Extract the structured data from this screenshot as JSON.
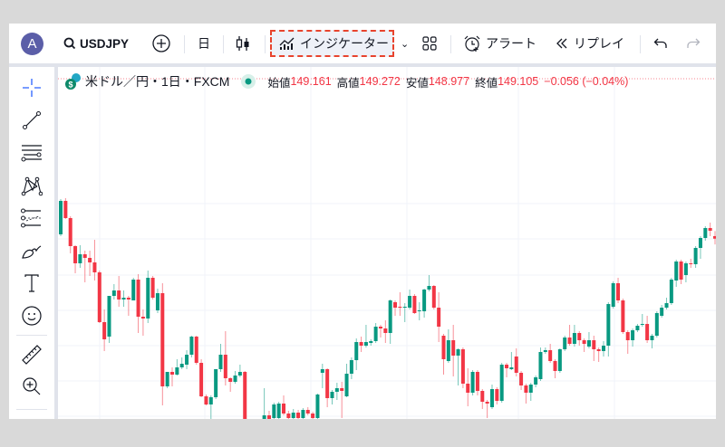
{
  "toolbar": {
    "avatar_letter": "A",
    "symbol": "USDJPY",
    "interval": "日",
    "indicators_label": "インジケーター",
    "alert_label": "アラート",
    "replay_label": "リプレイ"
  },
  "legend": {
    "title": "米ドル／円・1日・FXCM",
    "open_label": "始値",
    "open": "149.161",
    "high_label": "高値",
    "high": "149.272",
    "low_label": "安値",
    "low": "148.977",
    "close_label": "終値",
    "close": "149.105",
    "change": "−0.056 (−0.04%)"
  },
  "left_tools": [
    "crosshair",
    "trend-line",
    "horizontal-lines",
    "pattern",
    "fib-retracement",
    "brush",
    "text",
    "emoji",
    "ruler",
    "zoom-in"
  ],
  "colors": {
    "up": "#089981",
    "down": "#f23645",
    "accent": "#2962ff",
    "highlight": "#e8432d"
  },
  "chart_data": {
    "type": "candlestick",
    "symbol": "USDJPY",
    "interval": "1D",
    "ohlc": [
      [
        149.2,
        149.98,
        149.16,
        149.94
      ],
      [
        149.94,
        150.0,
        149.54,
        149.56
      ],
      [
        149.56,
        149.6,
        148.78,
        148.94
      ],
      [
        148.94,
        148.96,
        148.34,
        148.56
      ],
      [
        148.56,
        148.96,
        148.46,
        148.76
      ],
      [
        148.76,
        148.84,
        148.14,
        148.68
      ],
      [
        148.68,
        148.84,
        148.28,
        148.58
      ],
      [
        148.58,
        149.08,
        148.18,
        148.36
      ],
      [
        148.36,
        148.4,
        147.24,
        147.26
      ],
      [
        147.26,
        147.54,
        146.62,
        146.88
      ],
      [
        146.94,
        146.96,
        146.8,
        147.84
      ],
      [
        147.84,
        148.1,
        147.76,
        147.96
      ],
      [
        147.96,
        148.28,
        147.6,
        147.76
      ],
      [
        147.76,
        147.96,
        147.6,
        147.8
      ],
      [
        147.8,
        147.84,
        147.4,
        147.76
      ],
      [
        147.74,
        148.24,
        147.74,
        148.2
      ],
      [
        148.2,
        148.32,
        147.02,
        147.38
      ],
      [
        147.38,
        147.54,
        146.96,
        147.34
      ],
      [
        147.34,
        148.4,
        147.24,
        148.24
      ],
      [
        148.24,
        148.28,
        147.76,
        147.8
      ],
      [
        147.52,
        148.0,
        147.46,
        147.9
      ],
      [
        147.9,
        148.12,
        145.42,
        145.84
      ],
      [
        145.84,
        146.16,
        145.8,
        146.16
      ],
      [
        146.16,
        146.26,
        145.84,
        146.1
      ],
      [
        146.1,
        146.44,
        146.08,
        146.26
      ],
      [
        146.26,
        146.48,
        146.22,
        146.34
      ],
      [
        146.32,
        146.64,
        146.22,
        146.54
      ],
      [
        146.54,
        146.96,
        146.48,
        146.94
      ],
      [
        146.94,
        146.96,
        146.32,
        146.36
      ],
      [
        146.36,
        146.44,
        145.6,
        145.62
      ],
      [
        145.62,
        145.66,
        145.42,
        145.44
      ],
      [
        145.44,
        145.64,
        145.1,
        145.6
      ],
      [
        145.6,
        146.22,
        145.56,
        146.22
      ],
      [
        146.22,
        146.78,
        146.16,
        146.54
      ],
      [
        146.54,
        147.06,
        145.86,
        146.02
      ],
      [
        146.02,
        146.04,
        145.72,
        145.94
      ],
      [
        145.94,
        146.18,
        145.9,
        146.08
      ],
      [
        146.08,
        146.32,
        146.04,
        146.16
      ],
      [
        146.16,
        146.18,
        144.9,
        145.0
      ],
      [
        145.0,
        145.1,
        144.6,
        144.7
      ],
      [
        144.7,
        145.0,
        144.5,
        144.9
      ],
      [
        144.9,
        145.0,
        144.6,
        144.8
      ],
      [
        144.8,
        145.8,
        144.7,
        145.2
      ],
      [
        145.2,
        145.3,
        144.9,
        145.0
      ],
      [
        145.14,
        145.48,
        145.08,
        145.44
      ],
      [
        145.14,
        145.5,
        145.08,
        145.46
      ],
      [
        145.46,
        145.64,
        145.2,
        145.24
      ],
      [
        145.24,
        145.3,
        145.08,
        145.14
      ],
      [
        145.14,
        145.34,
        145.08,
        145.26
      ],
      [
        145.26,
        145.32,
        145.08,
        145.14
      ],
      [
        145.14,
        145.36,
        145.08,
        145.32
      ],
      [
        145.32,
        145.38,
        145.2,
        145.24
      ],
      [
        145.24,
        145.28,
        145.0,
        145.14
      ],
      [
        145.14,
        145.68,
        145.08,
        145.66
      ],
      [
        146.14,
        146.34,
        145.8,
        146.22
      ],
      [
        146.22,
        146.24,
        145.38,
        145.58
      ],
      [
        145.58,
        145.76,
        145.44,
        145.72
      ],
      [
        145.72,
        145.92,
        145.54,
        145.8
      ],
      [
        145.8,
        145.94,
        145.14,
        145.74
      ],
      [
        145.62,
        146.34,
        145.6,
        146.12
      ],
      [
        146.12,
        146.48,
        146.0,
        146.42
      ],
      [
        146.42,
        146.9,
        146.2,
        146.82
      ],
      [
        146.82,
        146.94,
        146.6,
        146.74
      ],
      [
        146.74,
        147.2,
        146.7,
        146.82
      ],
      [
        146.8,
        146.88,
        146.74,
        146.84
      ],
      [
        146.84,
        147.24,
        146.8,
        147.16
      ],
      [
        147.16,
        147.2,
        146.92,
        147.12
      ],
      [
        147.12,
        147.3,
        146.8,
        147.02
      ],
      [
        147.02,
        147.76,
        146.78,
        147.74
      ],
      [
        147.7,
        147.74,
        147.4,
        147.58
      ],
      [
        147.6,
        147.92,
        147.4,
        147.58
      ],
      [
        147.58,
        147.68,
        147.26,
        147.6
      ],
      [
        147.58,
        147.98,
        147.54,
        147.84
      ],
      [
        147.84,
        147.88,
        147.44,
        147.46
      ],
      [
        147.5,
        147.7,
        147.3,
        147.52
      ],
      [
        147.5,
        148.0,
        147.36,
        147.98
      ],
      [
        147.98,
        148.3,
        147.94,
        148.06
      ],
      [
        148.06,
        148.08,
        147.54,
        147.58
      ],
      [
        147.58,
        147.92,
        146.82,
        147.16
      ],
      [
        146.96,
        147.0,
        146.1,
        146.44
      ],
      [
        146.4,
        147.1,
        146.36,
        146.86
      ],
      [
        146.86,
        147.2,
        146.06,
        146.52
      ],
      [
        146.52,
        146.68,
        145.86,
        146.66
      ],
      [
        146.66,
        146.7,
        145.8,
        145.9
      ],
      [
        145.9,
        146.24,
        145.4,
        145.7
      ],
      [
        145.7,
        146.2,
        145.64,
        146.16
      ],
      [
        146.16,
        146.2,
        145.64,
        145.74
      ],
      [
        145.74,
        145.78,
        145.34,
        145.5
      ],
      [
        145.5,
        145.54,
        145.14,
        145.46
      ],
      [
        145.38,
        145.88,
        145.34,
        145.78
      ],
      [
        145.78,
        145.82,
        145.44,
        145.52
      ],
      [
        145.52,
        146.36,
        145.48,
        146.32
      ],
      [
        146.32,
        146.36,
        146.04,
        146.24
      ],
      [
        146.22,
        146.6,
        146.2,
        146.26
      ],
      [
        146.5,
        146.68,
        146.06,
        146.14
      ],
      [
        146.14,
        146.18,
        145.76,
        145.86
      ],
      [
        145.86,
        145.9,
        145.46,
        145.7
      ],
      [
        145.7,
        145.92,
        145.52,
        145.88
      ],
      [
        145.88,
        146.08,
        145.82,
        146.04
      ],
      [
        146.0,
        146.7,
        145.96,
        146.6
      ],
      [
        146.6,
        146.7,
        146.56,
        146.64
      ],
      [
        146.64,
        146.78,
        146.36,
        146.4
      ],
      [
        146.4,
        146.44,
        146.02,
        146.18
      ],
      [
        146.18,
        146.68,
        146.14,
        146.66
      ],
      [
        146.66,
        146.96,
        146.62,
        146.92
      ],
      [
        146.92,
        147.2,
        146.74,
        146.78
      ],
      [
        146.78,
        147.2,
        146.72,
        147.02
      ],
      [
        147.02,
        147.06,
        146.74,
        146.86
      ],
      [
        146.86,
        146.9,
        146.6,
        146.78
      ],
      [
        146.72,
        147.04,
        146.68,
        146.86
      ],
      [
        146.86,
        146.96,
        146.4,
        146.66
      ],
      [
        146.66,
        146.7,
        146.38,
        146.62
      ],
      [
        146.62,
        146.84,
        146.5,
        146.74
      ],
      [
        146.74,
        147.7,
        146.5,
        147.66
      ],
      [
        147.6,
        148.16,
        147.56,
        148.12
      ],
      [
        148.12,
        148.24,
        147.68,
        147.74
      ],
      [
        147.74,
        147.78,
        147.0,
        147.04
      ],
      [
        147.04,
        147.08,
        146.56,
        146.86
      ],
      [
        146.86,
        147.12,
        146.72,
        147.08
      ],
      [
        147.08,
        147.22,
        147.04,
        147.18
      ],
      [
        147.2,
        147.44,
        147.16,
        147.22
      ],
      [
        147.22,
        147.4,
        146.8,
        146.86
      ],
      [
        146.86,
        147.0,
        146.68,
        146.96
      ],
      [
        146.96,
        147.5,
        146.92,
        147.46
      ],
      [
        147.4,
        147.64,
        147.36,
        147.58
      ],
      [
        147.58,
        147.8,
        147.54,
        147.68
      ],
      [
        147.68,
        148.24,
        147.64,
        148.2
      ],
      [
        148.18,
        148.64,
        148.04,
        148.6
      ],
      [
        148.6,
        148.64,
        148.1,
        148.2
      ],
      [
        148.3,
        148.6,
        148.14,
        148.56
      ],
      [
        148.56,
        148.66,
        148.46,
        148.54
      ],
      [
        148.54,
        148.94,
        148.46,
        148.9
      ],
      [
        148.9,
        149.16,
        148.66,
        149.12
      ],
      [
        149.12,
        149.38,
        149.06,
        149.34
      ],
      [
        149.34,
        149.46,
        149.16,
        149.28
      ],
      [
        149.161,
        149.272,
        148.977,
        149.105
      ]
    ],
    "visible_price_range": [
      144.9,
      152.9
    ],
    "grid": true
  }
}
